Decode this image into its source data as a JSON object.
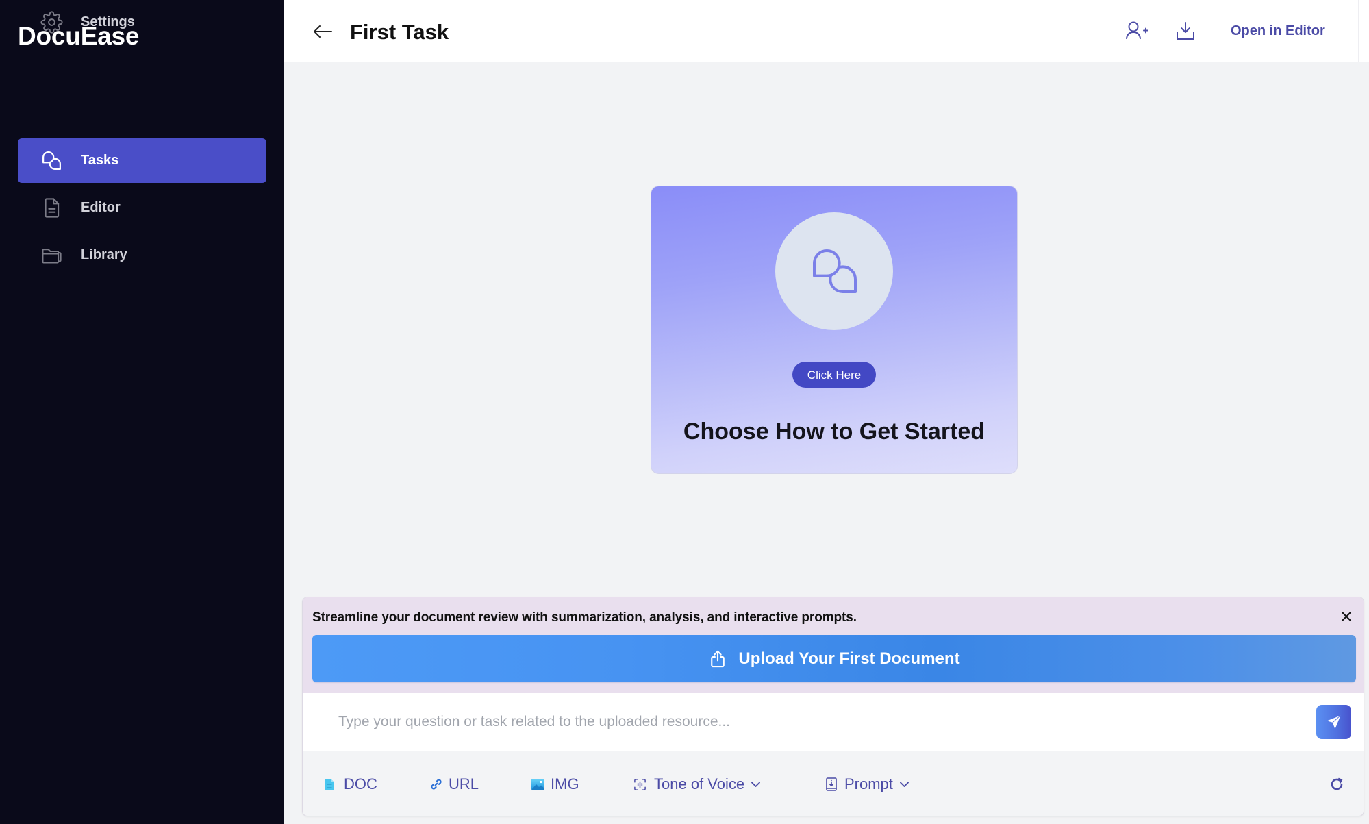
{
  "app": {
    "name": "DocuEase"
  },
  "sidebar": {
    "items": [
      {
        "label": "Tasks",
        "icon": "chat-bubbles-icon",
        "active": true
      },
      {
        "label": "Editor",
        "icon": "document-icon",
        "active": false
      },
      {
        "label": "Library",
        "icon": "folder-icon",
        "active": false
      },
      {
        "label": "Settings",
        "icon": "gear-icon",
        "active": false
      }
    ]
  },
  "header": {
    "back_icon": "arrow-left-icon",
    "title": "First Task",
    "add_user_icon": "user-plus-icon",
    "download_icon": "download-icon",
    "open_in_editor": "Open in Editor"
  },
  "card": {
    "icon": "chat-bubbles-icon",
    "button_label": "Click Here",
    "title": "Choose How to Get Started"
  },
  "panel": {
    "message": "Streamline your document review with summarization, analysis, and interactive prompts.",
    "close_icon": "close-icon",
    "upload_icon": "upload-icon",
    "upload_label": "Upload Your First Document",
    "input_placeholder": "Type your question or task related to the uploaded resource...",
    "input_value": "",
    "send_icon": "send-icon",
    "toolbar": [
      {
        "label": "DOC",
        "icon": "doc-file-icon"
      },
      {
        "label": "URL",
        "icon": "link-icon"
      },
      {
        "label": "IMG",
        "icon": "image-icon"
      },
      {
        "label": "Tone of Voice",
        "icon": "voice-scan-icon",
        "dropdown": true
      },
      {
        "label": "Prompt",
        "icon": "prompt-book-icon",
        "dropdown": true
      }
    ],
    "refresh_icon": "refresh-icon"
  },
  "colors": {
    "sidebar_bg": "#0a0a1a",
    "accent": "#4a4ec8",
    "link_text": "#4b4ba6",
    "upload_button": "#3d8be8",
    "panel_bg": "#e9dfee",
    "card_gradient_top": "#8a8df8",
    "card_gradient_bottom": "#dedefb",
    "main_bg": "#f2f3f5"
  }
}
